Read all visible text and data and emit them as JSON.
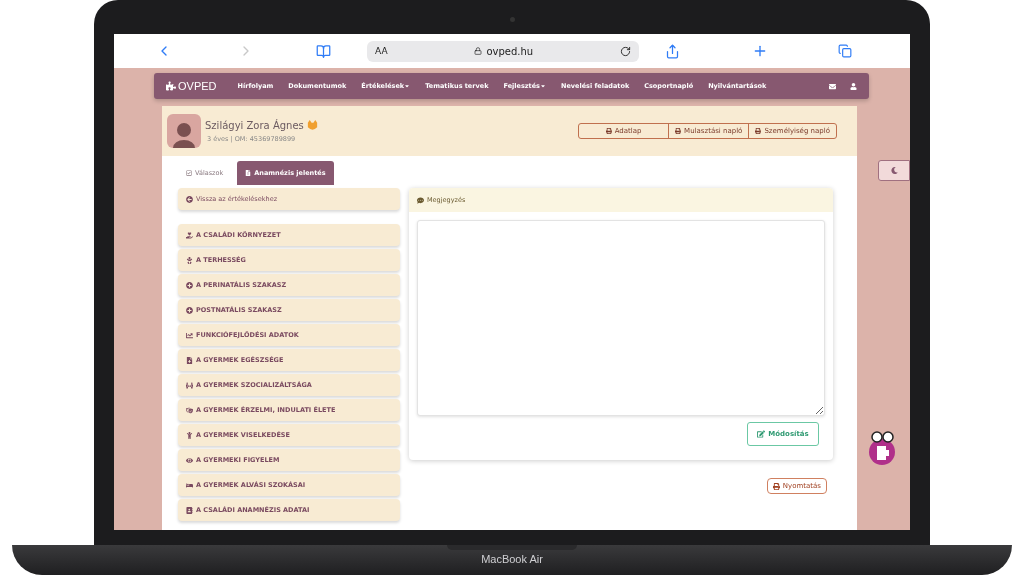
{
  "browser": {
    "text_size": "AA",
    "url": "ovped.hu"
  },
  "nav": {
    "logo": "OVPED",
    "items": [
      {
        "label": "Hírfolyam",
        "dropdown": false
      },
      {
        "label": "Dokumentumok",
        "dropdown": false
      },
      {
        "label": "Értékelések",
        "dropdown": true
      },
      {
        "label": "Tematikus tervek",
        "dropdown": false
      },
      {
        "label": "Fejlesztés",
        "dropdown": true
      },
      {
        "label": "Nevelési feladatok",
        "dropdown": false
      },
      {
        "label": "Csoportnapló",
        "dropdown": false
      },
      {
        "label": "Nyilvántartások",
        "dropdown": false
      }
    ]
  },
  "student": {
    "name": "Szilágyi Zora Ágnes",
    "info": "3 éves | OM: 45369789899"
  },
  "header_buttons": [
    "Adatlap",
    "Mulasztási napló",
    "Személyiség napló"
  ],
  "tabs": [
    {
      "label": "Válaszok",
      "selected": false
    },
    {
      "label": "Anamnézis jelentés",
      "selected": true
    }
  ],
  "back_link": "Vissza az értékelésekhez",
  "sections": [
    "A CSALÁDI KÖRNYEZET",
    "A TERHESSÉG",
    "A PERINATÁLIS SZAKASZ",
    "POSTNATÁLIS SZAKASZ",
    "FUNKCIÓFEJLŐDÉSI ADATOK",
    "A GYERMEK EGÉSZSÉGE",
    "A GYERMEK SZOCIALIZÁLTSÁGA",
    "A GYERMEK ÉRZELMI, INDULATI ÉLETE",
    "A GYERMEK VISELKEDÉSE",
    "A GYERMEKI FIGYELEM",
    "A GYERMEK ALVÁSI SZOKÁSAI",
    "A CSALÁDI ANAMNÉZIS ADATAI"
  ],
  "note": {
    "title": "Megjegyzés",
    "edit_button": "Módosítás"
  },
  "print_button": "Nyomtatás",
  "laptop_label": "MacBook Air"
}
